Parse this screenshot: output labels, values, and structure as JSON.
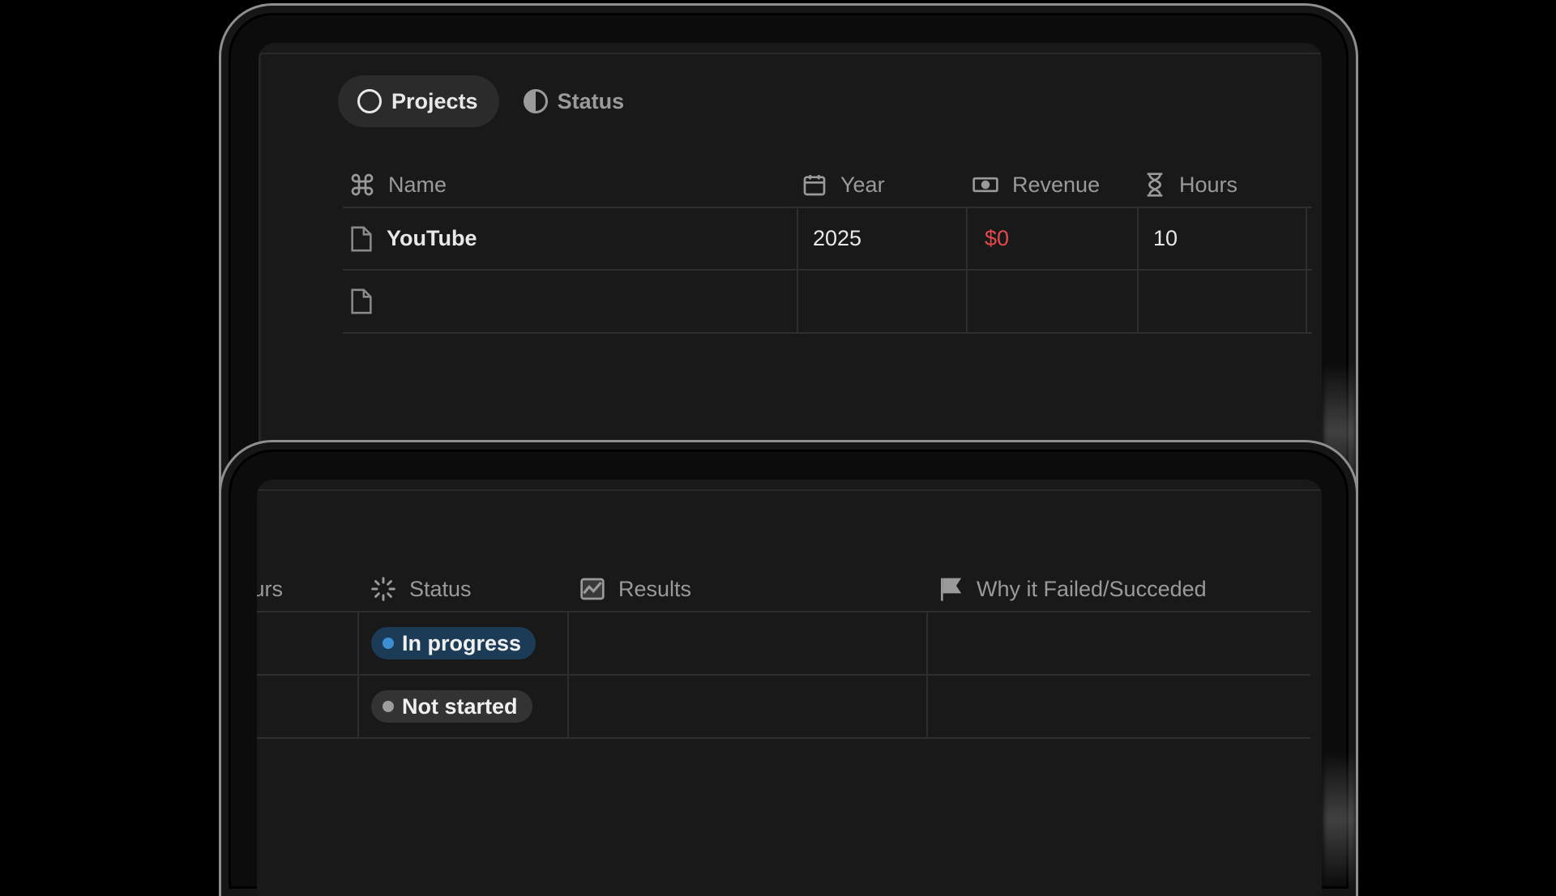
{
  "tabs": [
    {
      "label": "Projects",
      "icon": "circle-icon",
      "active": true
    },
    {
      "label": "Status",
      "icon": "half-circle-icon",
      "active": false
    }
  ],
  "top_table": {
    "columns": [
      {
        "label": "Name",
        "icon": "command-icon"
      },
      {
        "label": "Year",
        "icon": "calendar-icon"
      },
      {
        "label": "Revenue",
        "icon": "money-icon"
      },
      {
        "label": "Hours",
        "icon": "hourglass-icon"
      }
    ],
    "rows": [
      {
        "name": "YouTube",
        "year": "2025",
        "revenue": "$0",
        "hours": "10"
      },
      {
        "name": "",
        "year": "",
        "revenue": "",
        "hours": ""
      }
    ]
  },
  "bottom_table": {
    "columns": [
      {
        "label": "Hours",
        "icon": "hourglass-icon"
      },
      {
        "label": "Status",
        "icon": "loading-spinner-icon"
      },
      {
        "label": "Results",
        "icon": "chart-icon"
      },
      {
        "label": "Why it Failed/Succeded",
        "icon": "flag-icon"
      }
    ],
    "rows": [
      {
        "status": "In progress",
        "results": "",
        "why": ""
      },
      {
        "status": "Not started",
        "results": "",
        "why": ""
      }
    ]
  },
  "colors": {
    "background": "#000000",
    "screen": "#191919",
    "negative_value": "#e5484d",
    "in_progress": "#3d8fd1",
    "not_started": "#9d9d9d"
  }
}
